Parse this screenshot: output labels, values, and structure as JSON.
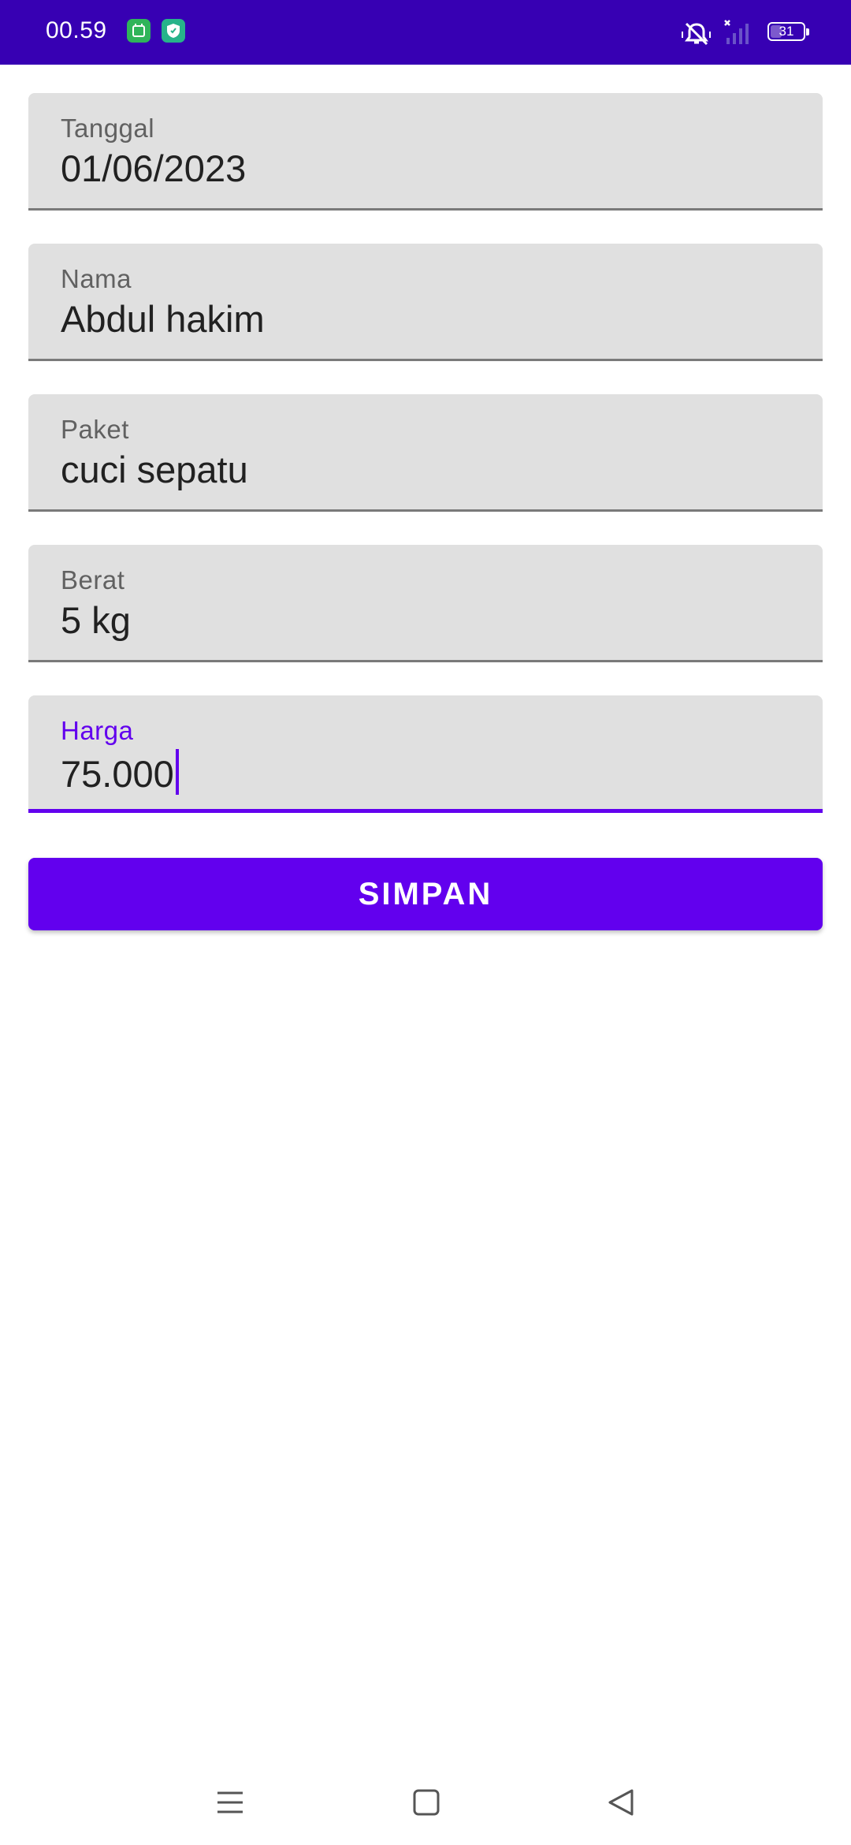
{
  "status_bar": {
    "time": "00.59",
    "battery_level": "31",
    "background_color": "#3700b3",
    "icons": [
      "notification-app-icon",
      "shield-app-icon",
      "silent-mode-icon",
      "no-signal-icon",
      "battery-icon"
    ]
  },
  "form": {
    "fields": [
      {
        "label": "Tanggal",
        "value": "01/06/2023"
      },
      {
        "label": "Nama",
        "value": "Abdul hakim"
      },
      {
        "label": "Paket",
        "value": "cuci sepatu"
      },
      {
        "label": "Berat",
        "value": "5 kg"
      },
      {
        "label": "Harga",
        "value": "75.000"
      }
    ],
    "focused_field": "Harga"
  },
  "save_button": {
    "label": "SIMPAN",
    "color": "#6200ee"
  },
  "nav_bar": {
    "icons": [
      "menu-icon",
      "home-icon",
      "back-icon"
    ]
  }
}
